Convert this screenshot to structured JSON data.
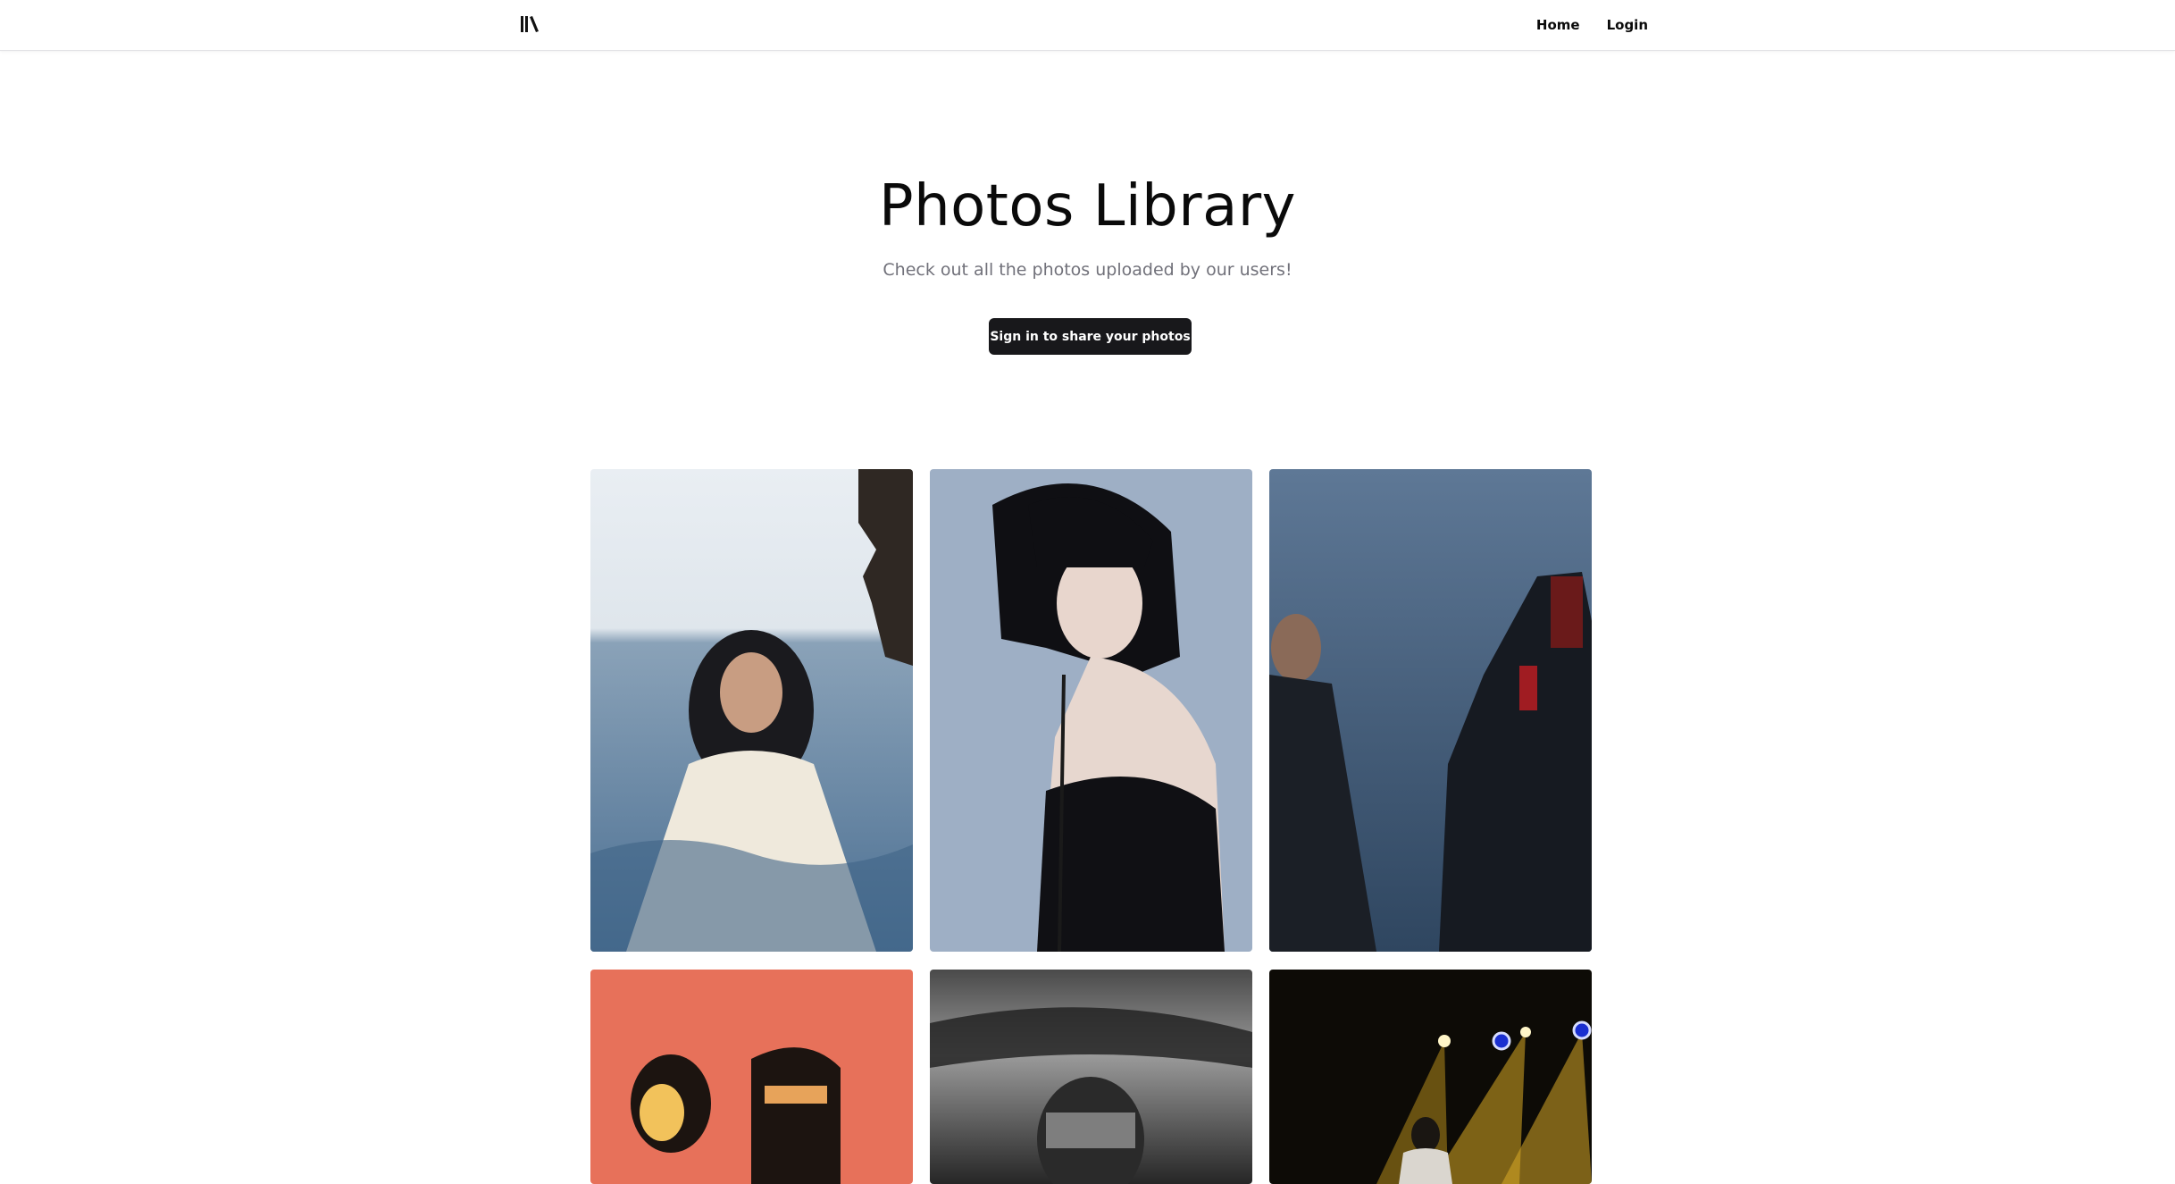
{
  "header": {
    "logo_icon": "library-books-icon",
    "nav": [
      {
        "label": "Home"
      },
      {
        "label": "Login"
      }
    ]
  },
  "hero": {
    "title": "Photos Library",
    "subtitle": "Check out all the photos uploaded by our users!",
    "cta_label": "Sign in to share your photos"
  },
  "gallery": {
    "photos": [
      {
        "subject": "woman-by-sea"
      },
      {
        "subject": "woman-bob-haircut"
      },
      {
        "subject": "two-men-hooded"
      },
      {
        "subject": "duo-red-poster"
      },
      {
        "subject": "black-white-figure"
      },
      {
        "subject": "stage-singer-lights"
      }
    ]
  },
  "colors": {
    "primary_button": "#18181b",
    "muted_text": "#71717a",
    "border": "#e4e4e7"
  }
}
